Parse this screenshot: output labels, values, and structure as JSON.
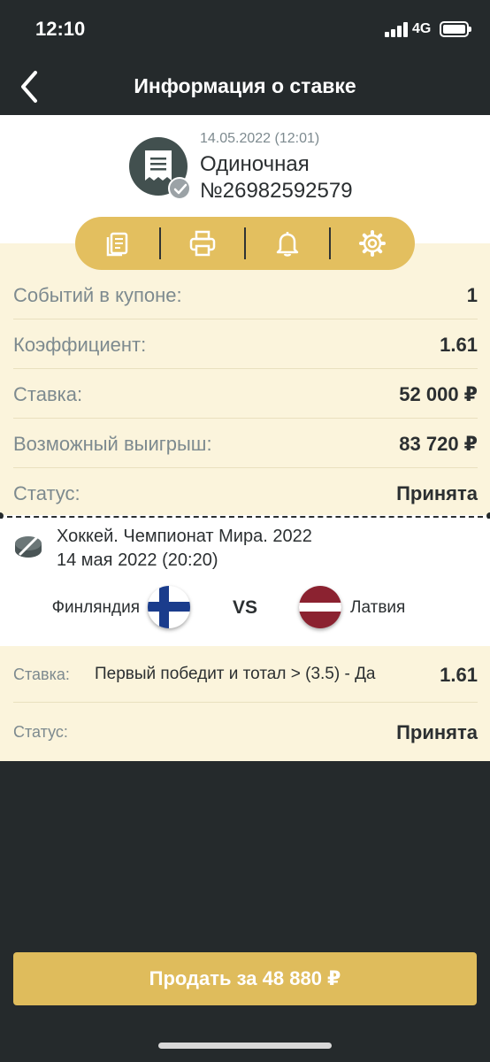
{
  "status_bar": {
    "time": "12:10",
    "network": "4G"
  },
  "nav": {
    "title": "Информация о ставке",
    "back_icon": "chevron-left-icon"
  },
  "bet_header": {
    "date": "14.05.2022 (12:01)",
    "type": "Одиночная",
    "number": "№26982592579",
    "icon": "receipt-icon",
    "badge_icon": "check-icon"
  },
  "actions": [
    {
      "name": "copy-document",
      "icon": "document-icon"
    },
    {
      "name": "print",
      "icon": "printer-icon"
    },
    {
      "name": "notifications",
      "icon": "bell-icon"
    },
    {
      "name": "settings",
      "icon": "gear-icon"
    }
  ],
  "info_rows": [
    {
      "label": "Событий в купоне:",
      "value": "1"
    },
    {
      "label": "Коэффициент:",
      "value": "1.61"
    },
    {
      "label": "Ставка:",
      "value": "52 000 ₽"
    },
    {
      "label": "Возможный выигрыш:",
      "value": "83 720 ₽"
    },
    {
      "label": "Статус:",
      "value": "Принята"
    }
  ],
  "event": {
    "title": "Хоккей. Чемпионат Мира. 2022",
    "date": "14 мая 2022 (20:20)",
    "team1": "Финляндия",
    "team2": "Латвия",
    "vs": "VS"
  },
  "bet_details": {
    "stake_label": "Ставка:",
    "stake_desc": "Первый победит и тотал > (3.5) - Да",
    "stake_odds": "1.61",
    "status_label": "Статус:",
    "status_value": "Принята"
  },
  "sell_button": "Продать за 48 880 ₽",
  "colors": {
    "background": "#252a2c",
    "accent": "#e3bf5f",
    "card_cream": "#fbf4dc",
    "muted_text": "#7d8a8f"
  }
}
